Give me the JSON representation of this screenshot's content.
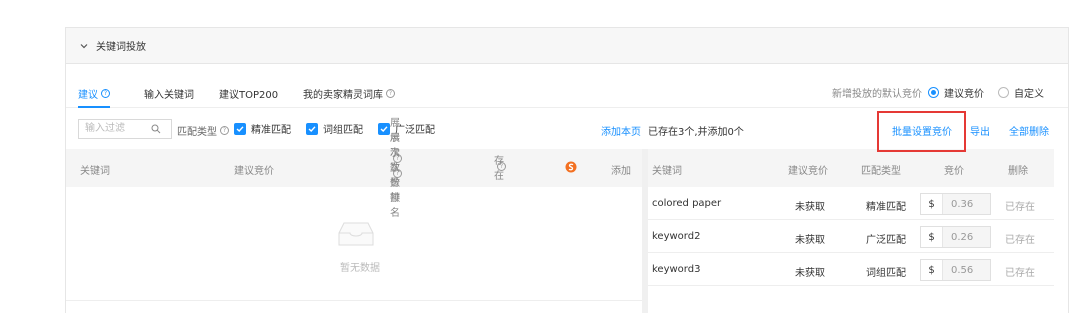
{
  "panel": {
    "title": "关键词投放"
  },
  "tabs": [
    {
      "label": "建议"
    },
    {
      "label": "输入关键词"
    },
    {
      "label": "建议TOP200"
    },
    {
      "label": "我的卖家精灵词库"
    }
  ],
  "default_bid": {
    "label": "新增投放的默认竞价",
    "options": [
      "建议竞价",
      "自定义"
    ],
    "selected": "建议竞价"
  },
  "filter": {
    "placeholder": "输入过滤",
    "match_type_label": "匹配类型",
    "checkboxes": [
      "精准匹配",
      "词组匹配",
      "广泛匹配"
    ]
  },
  "actions": {
    "add_page": "添加本页",
    "exist_info": "已存在3个,并添加0个",
    "batch_bid": "批量设置竞价",
    "export": "导出",
    "delete_all": "全部删除"
  },
  "left_table": {
    "headers": {
      "keyword": "关键词",
      "suggested_bid": "建议竞价",
      "impression_share": "展示次数份额",
      "impression_rank": "展示次数排名",
      "exists": "存在",
      "add": "添加"
    },
    "empty_text": "暂无数据"
  },
  "right_table": {
    "headers": {
      "keyword": "关键词",
      "suggested_bid": "建议竞价",
      "match_type": "匹配类型",
      "bid": "竞价",
      "delete": "删除"
    },
    "rows": [
      {
        "keyword": "colored paper",
        "suggested": "未获取",
        "match": "精准匹配",
        "currency": "$",
        "bid": "0.36",
        "status": "已存在"
      },
      {
        "keyword": "keyword2",
        "suggested": "未获取",
        "match": "广泛匹配",
        "currency": "$",
        "bid": "0.26",
        "status": "已存在"
      },
      {
        "keyword": "keyword3",
        "suggested": "未获取",
        "match": "词组匹配",
        "currency": "$",
        "bid": "0.56",
        "status": "已存在"
      }
    ]
  },
  "colors": {
    "accent": "#1890ff",
    "highlight": "#e53935",
    "brand_icon": "#f37021"
  }
}
